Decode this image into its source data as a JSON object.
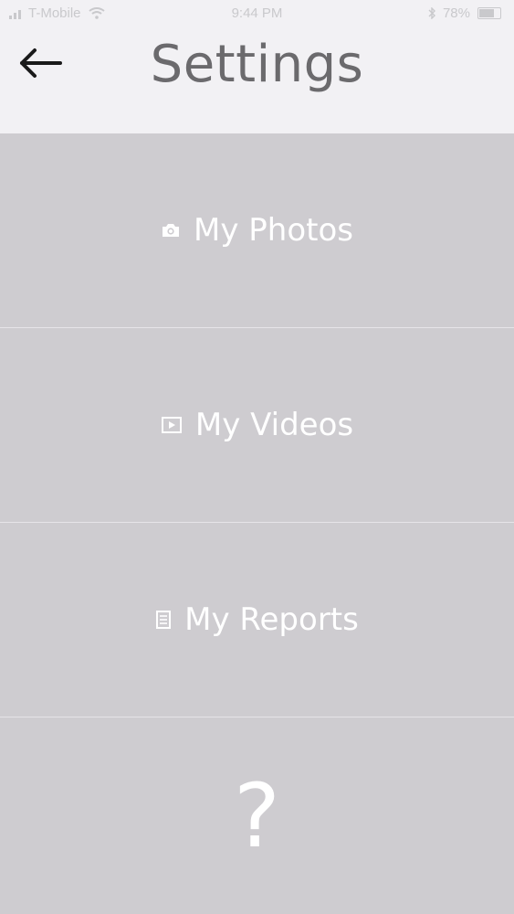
{
  "status_bar": {
    "carrier": "T-Mobile",
    "time": "9:44 PM",
    "battery": "78%"
  },
  "header": {
    "title": "Settings",
    "back_icon": "arrow-left-icon"
  },
  "menu": {
    "items": [
      {
        "label": "My Photos",
        "icon": "camera-icon"
      },
      {
        "label": "My Videos",
        "icon": "video-play-icon"
      },
      {
        "label": "My Reports",
        "icon": "document-icon"
      },
      {
        "label": "?",
        "icon": "help-icon"
      }
    ]
  },
  "colors": {
    "header_bg": "#f2f1f4",
    "menu_bg": "#ceccd0",
    "title_text": "#6b6a6d",
    "menu_text": "#ffffff",
    "divider": "#e6e4e8"
  }
}
